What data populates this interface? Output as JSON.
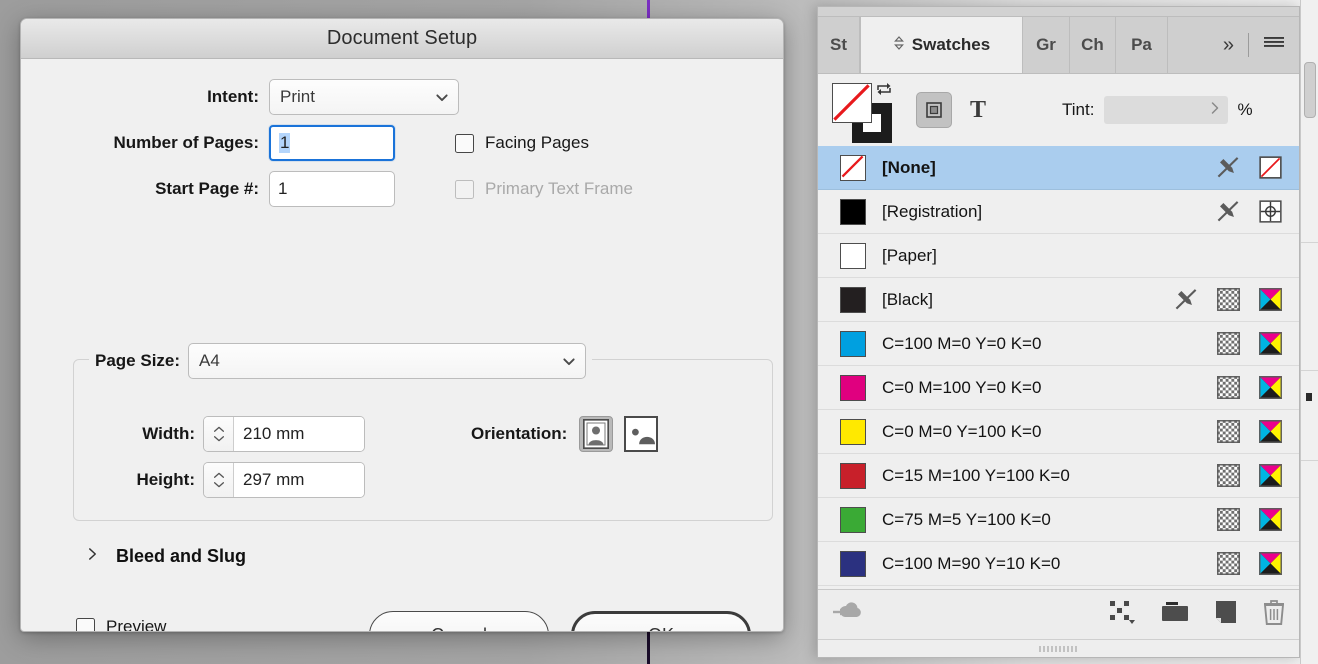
{
  "dialog": {
    "title": "Document Setup",
    "fields": {
      "intent_label": "Intent:",
      "intent_value": "Print",
      "pages_label": "Number of Pages:",
      "pages_value": "1",
      "start_label": "Start Page #:",
      "start_value": "1",
      "facing_pages_label": "Facing Pages",
      "primary_text_frame_label": "Primary Text Frame",
      "page_size_label": "Page Size:",
      "page_size_value": "A4",
      "width_label": "Width:",
      "width_value": "210 mm",
      "height_label": "Height:",
      "height_value": "297 mm",
      "orientation_label": "Orientation:",
      "orientation_portrait": "portrait",
      "orientation_landscape": "landscape"
    },
    "bleed_and_slug": "Bleed and Slug",
    "preview_label": "Preview",
    "buttons": {
      "cancel": "Cancel",
      "ok": "OK"
    }
  },
  "panel": {
    "tabs": [
      {
        "label": "St",
        "active": false
      },
      {
        "label": "Swatches",
        "active": true
      },
      {
        "label": "Gr",
        "active": false
      },
      {
        "label": "Ch",
        "active": false
      },
      {
        "label": "Pa",
        "active": false
      }
    ],
    "overflow_label": "»",
    "menu_icon": "hamburger-menu-icon",
    "toolbar": {
      "fill_icon": "fill-none-icon",
      "stroke_icon": "stroke-black-icon",
      "swap_icon": "swap-fill-stroke-icon",
      "format_container_icon": "format-affects-container-icon",
      "format_text_label": "T",
      "tint_label": "Tint:",
      "tint_value": "",
      "tint_unit": "%"
    },
    "swatches": [
      {
        "name": "[None]",
        "color": "none",
        "bold": true,
        "selected": true,
        "icons": [
          "no-edit-icon",
          "none-swatch-icon"
        ]
      },
      {
        "name": "[Registration]",
        "color": "#000000",
        "bold": false,
        "selected": false,
        "icons": [
          "no-edit-icon",
          "registration-icon"
        ]
      },
      {
        "name": "[Paper]",
        "color": "#ffffff",
        "bold": false,
        "selected": false,
        "icons": []
      },
      {
        "name": "[Black]",
        "color": "#231f20",
        "bold": false,
        "selected": false,
        "icons": [
          "no-edit-icon",
          "tint-grid-icon",
          "cmyk-icon"
        ]
      },
      {
        "name": "C=100 M=0 Y=0 K=0",
        "color": "#00a0e0",
        "bold": false,
        "selected": false,
        "icons": [
          "tint-grid-icon",
          "cmyk-icon"
        ]
      },
      {
        "name": "C=0 M=100 Y=0 K=0",
        "color": "#e0007f",
        "bold": false,
        "selected": false,
        "icons": [
          "tint-grid-icon",
          "cmyk-icon"
        ]
      },
      {
        "name": "C=0 M=0 Y=100 K=0",
        "color": "#ffe900",
        "bold": false,
        "selected": false,
        "icons": [
          "tint-grid-icon",
          "cmyk-icon"
        ]
      },
      {
        "name": "C=15 M=100 Y=100 K=0",
        "color": "#c8202a",
        "bold": false,
        "selected": false,
        "icons": [
          "tint-grid-icon",
          "cmyk-icon"
        ]
      },
      {
        "name": "C=75 M=5 Y=100 K=0",
        "color": "#3aaa35",
        "bold": false,
        "selected": false,
        "icons": [
          "tint-grid-icon",
          "cmyk-icon"
        ]
      },
      {
        "name": "C=100 M=90 Y=10 K=0",
        "color": "#2b3180",
        "bold": false,
        "selected": false,
        "icons": [
          "tint-grid-icon",
          "cmyk-icon"
        ]
      }
    ],
    "footer": {
      "library_icon": "cc-library-icon",
      "new_color_group_icon": "new-color-group-icon",
      "folder_icon": "color-group-folder-icon",
      "new_swatch_icon": "new-swatch-icon",
      "delete_icon": "delete-swatch-icon"
    }
  },
  "colors": {
    "selection_blue": "#aacdee",
    "focus_blue": "#1a73d9",
    "text_selection": "#b4d5fb",
    "panel_bg": "#efefef",
    "dialog_bg": "#f0f0f0"
  }
}
